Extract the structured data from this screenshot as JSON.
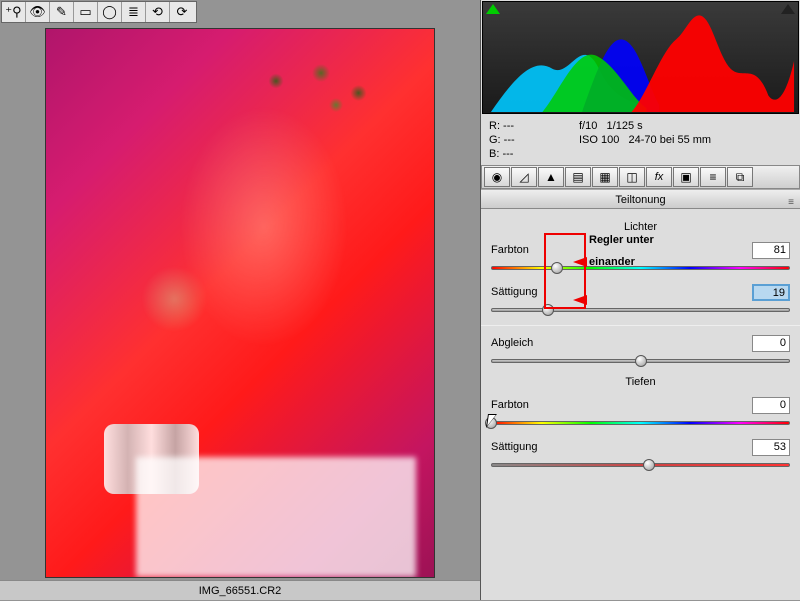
{
  "filename": "IMG_66551.CR2",
  "toolbar_icons": [
    "magnify-plus-icon",
    "eye-icon",
    "brush-icon",
    "rect-icon",
    "oval-icon",
    "list-icon",
    "rotate-ccw-icon",
    "rotate-cw-icon"
  ],
  "info": {
    "r": "R:     ---",
    "g": "G:     ---",
    "b": "B:     ---",
    "aperture": "f/10",
    "shutter": "1/125 s",
    "iso": "ISO 100",
    "lens": "24-70 bei 55 mm"
  },
  "tabstrip_icons": [
    "aperture-icon",
    "tone-icon",
    "triangle-icon",
    "crop-icon",
    "crop2-icon",
    "split-icon",
    "fx-icon",
    "camera-icon",
    "sliders-icon",
    "presets-icon"
  ],
  "panel": {
    "title": "Teiltonung",
    "highlights_label": "Lichter",
    "shadows_label": "Tiefen",
    "hue_label": "Farbton",
    "sat_label": "Sättigung",
    "balance_label": "Abgleich",
    "highlights": {
      "hue": "81",
      "sat": "19",
      "hue_pct": 22,
      "sat_pct": 19
    },
    "balance": {
      "value": "0",
      "pct": 50
    },
    "shadows": {
      "hue": "0",
      "sat": "53",
      "hue_pct": 0,
      "sat_pct": 53
    }
  },
  "annotation": {
    "line1": "Regler unter",
    "line2": "einander"
  }
}
